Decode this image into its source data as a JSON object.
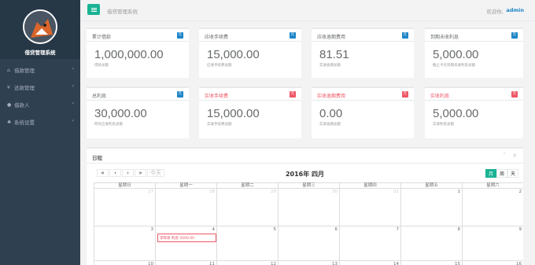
{
  "sidebar": {
    "app_name": "借贷管理系统",
    "items": [
      {
        "icon": "home-icon",
        "glyph": "⌂",
        "label": "借款管理"
      },
      {
        "icon": "yen-icon",
        "glyph": "¥",
        "label": "还款管理"
      },
      {
        "icon": "user-icon",
        "glyph": "●",
        "label": "借款人"
      },
      {
        "icon": "settings-icon",
        "glyph": "♣",
        "label": "系统设置"
      }
    ]
  },
  "header": {
    "title": "借贷管理系统",
    "welcome": "欢迎你,",
    "user": "admin"
  },
  "stats_row1": [
    {
      "title": "累计借款",
      "badge": "元",
      "value": "1,000,000.00",
      "sub": "借款总额"
    },
    {
      "title": "应收手续费",
      "badge": "元",
      "value": "15,000.00",
      "sub": "应收手续费总额"
    },
    {
      "title": "应收逾期费用",
      "badge": "元",
      "value": "81.51",
      "sub": "实收逾期总额"
    },
    {
      "title": "到期未收利息",
      "badge": "元",
      "value": "5,000.00",
      "sub": "截止今天到期未收利息总额"
    }
  ],
  "stats_row2": [
    {
      "title": "总利息",
      "badge": "元",
      "value": "30,000.00",
      "sub": "所有应收利息总额"
    },
    {
      "title": "实收手续费",
      "badge": "元",
      "value": "15,000.00",
      "sub": "实收手续费总额"
    },
    {
      "title": "实收逾期费用",
      "badge": "元",
      "value": "0.00",
      "sub": "实收逾期总额"
    },
    {
      "title": "实收利息",
      "badge": "元",
      "value": "5,000.00",
      "sub": "实收利息总额"
    }
  ],
  "calendar": {
    "title": "日程",
    "tools": {
      "collapse": "˄",
      "close": "✕"
    },
    "nav": {
      "prev_year": "«",
      "prev": "‹",
      "next": "›",
      "next_year": "»",
      "today": "今天"
    },
    "month_label": "2016年 四月",
    "views": [
      "月",
      "周",
      "天"
    ],
    "weekdays": [
      "星期日",
      "星期一",
      "星期二",
      "星期三",
      "星期四",
      "星期五",
      "星期六"
    ],
    "weeks": [
      [
        "27",
        "28",
        "29",
        "30",
        "31",
        "1",
        "2"
      ],
      [
        "3",
        "4",
        "5",
        "6",
        "7",
        "8",
        "9"
      ],
      [
        "10",
        "11",
        "12",
        "13",
        "14",
        "15",
        "16"
      ]
    ],
    "event_text": "李晔章 利息 5000.00"
  },
  "colors": {
    "accent": "#1ab394",
    "danger": "#ed5565",
    "info": "#1c84c6",
    "sidebar": "#2f4050"
  }
}
